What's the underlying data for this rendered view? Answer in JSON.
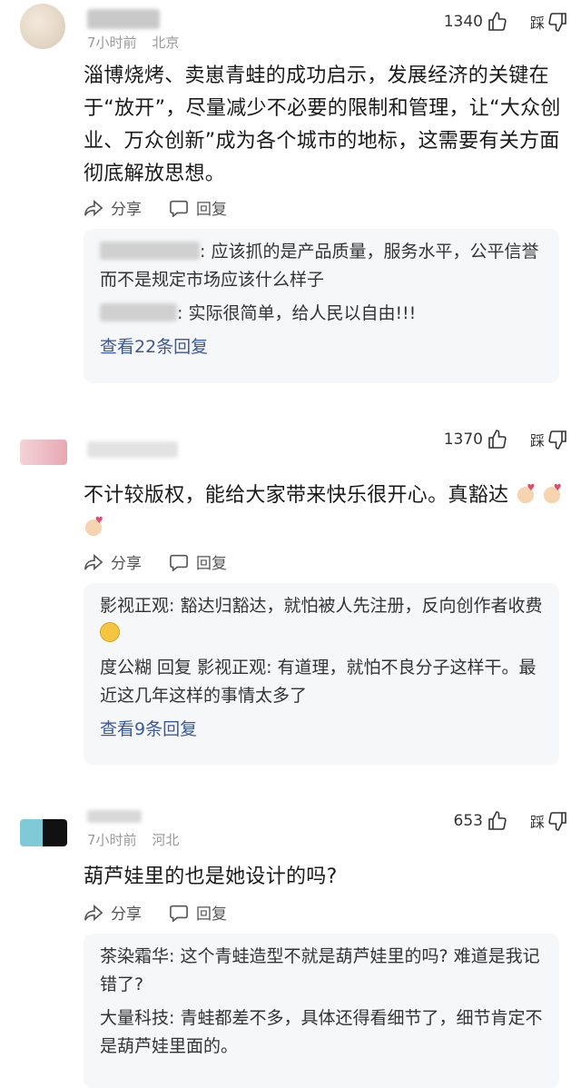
{
  "comments": [
    {
      "meta_time": "7小时前",
      "meta_location": "北京",
      "likes": "1340",
      "dislike_label": "踩",
      "text": "淄博烧烤、卖崽青蛙的成功启示，发展经济的关键在于“放开”，尽量减少不必要的限制和管理，让“大众创业、万众创新”成为各个城市的地标，这需要有关方面彻底解放思想。",
      "share_label": "分享",
      "reply_label": "回复",
      "replies": [
        {
          "name": "",
          "text": ": 应该抓的是产品质量，服务水平，公平信誉而不是规定市场应该什么样子"
        },
        {
          "name": "",
          "text": ": 实际很简单，给人民以自由!!!"
        }
      ],
      "view_more": "查看22条回复"
    },
    {
      "meta_time": "",
      "meta_location": "",
      "likes": "1370",
      "dislike_label": "踩",
      "text": "不计较版权，能给大家带来快乐很开心。真豁达",
      "share_label": "分享",
      "reply_label": "回复",
      "replies": [
        {
          "name": "影视正观",
          "text": ": 豁达归豁达，就怕被人先注册，反向创作者收费"
        },
        {
          "name": "度公糊 回复 影视正观",
          "text": ": 有道理，就怕不良分子这样干。最近这几年这样的事情太多了"
        }
      ],
      "view_more": "查看9条回复"
    },
    {
      "meta_time": "7小时前",
      "meta_location": "河北",
      "likes": "653",
      "dislike_label": "踩",
      "text": "葫芦娃里的也是她设计的吗?",
      "share_label": "分享",
      "reply_label": "回复",
      "replies": [
        {
          "name": "茶染霜华",
          "text": ": 这个青蛙造型不就是葫芦娃里的吗? 难道是我记错了?"
        },
        {
          "name": "大量科技",
          "text": ": 青蛙都差不多，具体还得看细节了，细节肯定不是葫芦娃里面的。"
        }
      ],
      "view_more": ""
    }
  ],
  "colors": {
    "link": "#3b5998",
    "reply_bg": "#f6f7f9",
    "meta": "#999999"
  }
}
